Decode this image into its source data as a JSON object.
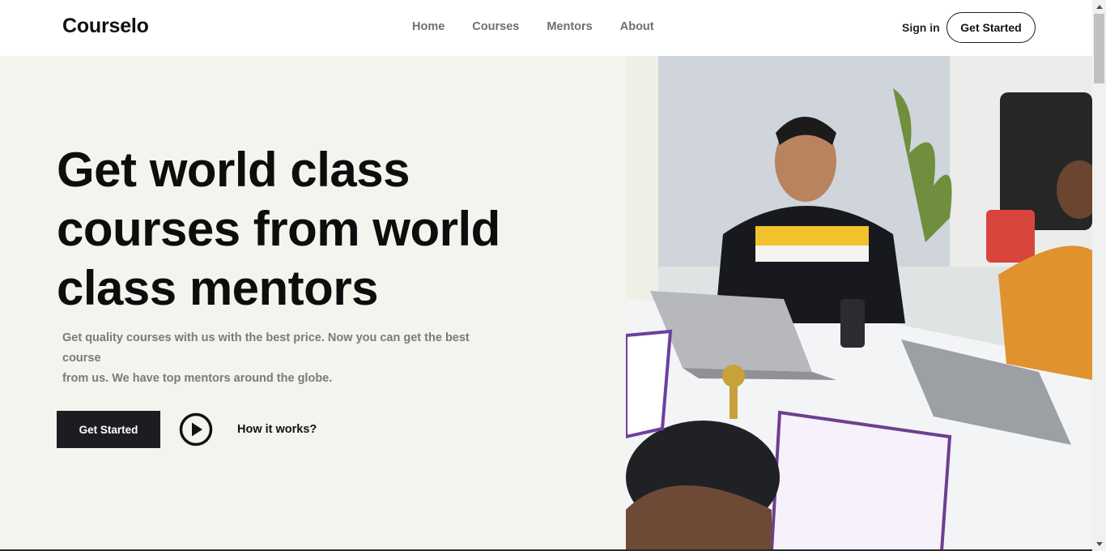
{
  "header": {
    "logo": "Courselo",
    "nav": [
      "Home",
      "Courses",
      "Mentors",
      "About"
    ],
    "signin_label": "Sign in",
    "cta_label": "Get Started"
  },
  "hero": {
    "headline_lines": [
      "Get world class",
      "courses from world",
      "class mentors"
    ],
    "subtext_lines": [
      "Get quality courses with us with the best price. Now you can get the best course",
      "from us. We have top mentors around the globe."
    ],
    "primary_cta": "Get Started",
    "secondary_link": "How it works?",
    "play_icon": "play-circle-icon"
  },
  "colors": {
    "hero_background": "#f4f3ee",
    "dark_button": "#1d1c20",
    "nav_text": "#6f6f6f",
    "subtext": "#7a7a7a"
  },
  "photo": {
    "description_icon": "hero-photo"
  }
}
